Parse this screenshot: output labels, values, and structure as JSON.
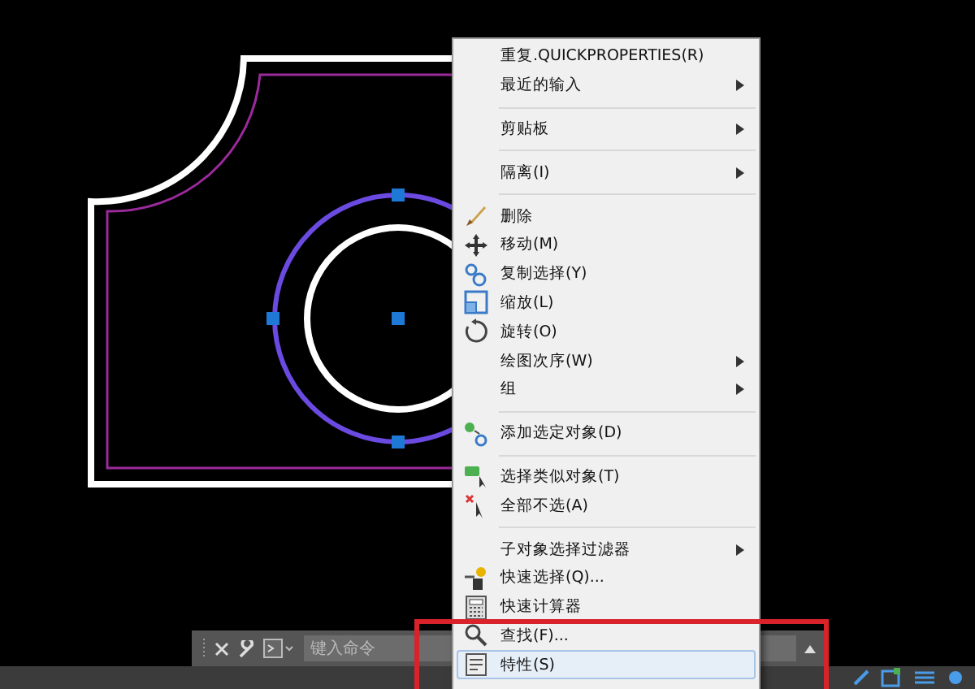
{
  "command_line": {
    "placeholder": "键入命令"
  },
  "context_menu": {
    "items": [
      {
        "kind": "item",
        "label": "重复.QUICKPROPERTIES(R)",
        "submenu": false,
        "selected": false
      },
      {
        "kind": "item",
        "label": "最近的输入",
        "submenu": true,
        "selected": false
      },
      {
        "kind": "separator"
      },
      {
        "kind": "item",
        "label": "剪贴板",
        "submenu": true,
        "selected": false
      },
      {
        "kind": "separator"
      },
      {
        "kind": "item",
        "label": "隔离(I)",
        "submenu": true,
        "selected": false
      },
      {
        "kind": "separator"
      },
      {
        "kind": "item",
        "label": "删除",
        "submenu": false,
        "selected": false
      },
      {
        "kind": "item",
        "label": "移动(M)",
        "submenu": false,
        "selected": false
      },
      {
        "kind": "item",
        "label": "复制选择(Y)",
        "submenu": false,
        "selected": false
      },
      {
        "kind": "item",
        "label": "缩放(L)",
        "submenu": false,
        "selected": false
      },
      {
        "kind": "item",
        "label": "旋转(O)",
        "submenu": false,
        "selected": false
      },
      {
        "kind": "item",
        "label": "绘图次序(W)",
        "submenu": true,
        "selected": false
      },
      {
        "kind": "item",
        "label": "组",
        "submenu": true,
        "selected": false
      },
      {
        "kind": "separator"
      },
      {
        "kind": "item",
        "label": "添加选定对象(D)",
        "submenu": false,
        "selected": false
      },
      {
        "kind": "separator"
      },
      {
        "kind": "item",
        "label": "选择类似对象(T)",
        "submenu": false,
        "selected": false
      },
      {
        "kind": "item",
        "label": "全部不选(A)",
        "submenu": false,
        "selected": false
      },
      {
        "kind": "separator"
      },
      {
        "kind": "item",
        "label": "子对象选择过滤器",
        "submenu": true,
        "selected": false
      },
      {
        "kind": "item",
        "label": "快速选择(Q)...",
        "submenu": false,
        "selected": false
      },
      {
        "kind": "item",
        "label": "快速计算器",
        "submenu": false,
        "selected": false
      },
      {
        "kind": "item",
        "label": "查找(F)...",
        "submenu": false,
        "selected": false
      },
      {
        "kind": "item",
        "label": "特性(S)",
        "submenu": false,
        "selected": true
      }
    ]
  }
}
